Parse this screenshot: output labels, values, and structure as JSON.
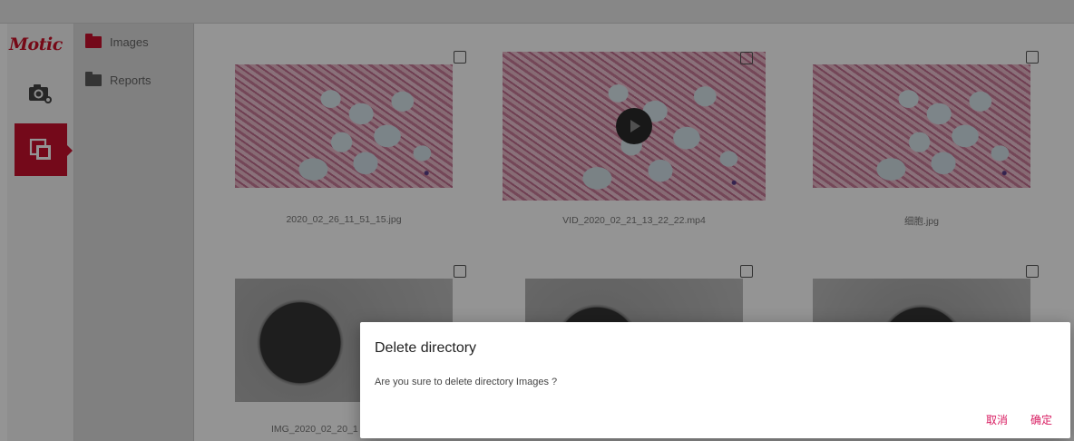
{
  "app": {
    "logo": "Motic"
  },
  "nav": {
    "items": [
      {
        "icon": "camera-icon"
      },
      {
        "icon": "gallery-icon",
        "active": true
      }
    ]
  },
  "folders": [
    {
      "label": "Images",
      "icon": "folder-icon",
      "active": true
    },
    {
      "label": "Reports",
      "icon": "folder-icon",
      "active": false
    }
  ],
  "files": [
    {
      "name": "2020_02_26_11_51_15.jpg",
      "kind": "image"
    },
    {
      "name": "VID_2020_02_21_13_22_22.mp4",
      "kind": "video"
    },
    {
      "name": "细胞.jpg",
      "kind": "image"
    },
    {
      "name": "IMG_2020_02_20_1",
      "kind": "image"
    },
    {
      "name": "",
      "kind": "image"
    },
    {
      "name": "",
      "kind": "image"
    }
  ],
  "dialog": {
    "title": "Delete directory",
    "message": "Are you sure to delete directory Images ?",
    "cancel_label": "取消",
    "confirm_label": "确定"
  },
  "colors": {
    "accent": "#c8102e",
    "dialog_button": "#d81b60"
  }
}
